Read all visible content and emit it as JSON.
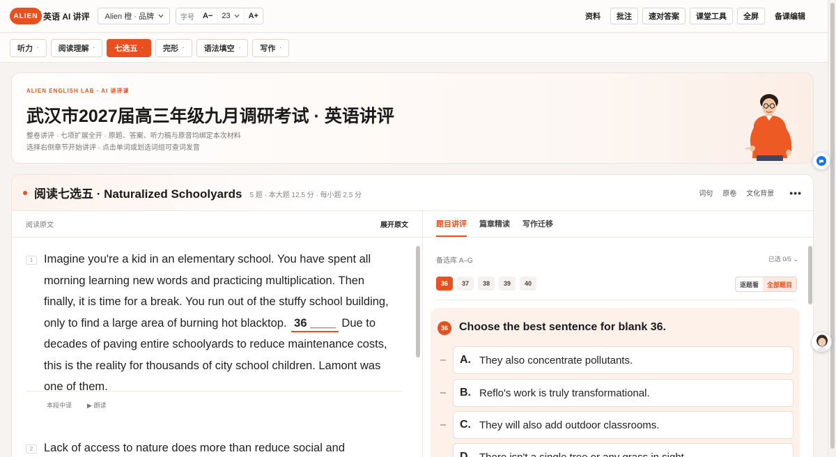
{
  "topbar": {
    "logo_text": "ALIEN",
    "app_title": "英语 AI 讲评",
    "brand_select": "Alien 橙 · 品牌",
    "font_label": "字号",
    "font_decrease": "A−",
    "font_size": "23",
    "font_increase": "A+",
    "right_buttons": [
      "资料",
      "批注",
      "速对答案",
      "课堂工具",
      "全屏",
      "备课编辑"
    ]
  },
  "nav": {
    "tabs": [
      {
        "label": "听力",
        "active": false
      },
      {
        "label": "阅读理解",
        "active": false
      },
      {
        "label": "七选五",
        "active": true
      },
      {
        "label": "完形",
        "active": false
      },
      {
        "label": "语法填空",
        "active": false
      },
      {
        "label": "写作",
        "active": false
      }
    ],
    "dot": "·"
  },
  "hero": {
    "eyebrow": "ALIEN ENGLISH LAB · AI 讲评课",
    "title": "武汉市2027届高三年级九月调研考试 · 英语讲评",
    "subtitle1": "整卷讲评 · 七项扩展全开 · 原题、答案、听力稿与原音均绑定本次材料",
    "subtitle2": "选择右侧章节开始讲评 · 点击单词或划选词组可查词发音"
  },
  "panel": {
    "title": "阅读七选五 · Naturalized Schoolyards",
    "meta": "5 题 · 本大题 12.5 分 · 每小题 2.5 分",
    "links": [
      "词句",
      "原卷",
      "文化背景"
    ],
    "more": "•••"
  },
  "left": {
    "label": "阅读原文",
    "expand": "展开原文",
    "paragraphs": [
      {
        "num": "1",
        "text_before": "Imagine you're a kid in an elementary school. You have spent all morning learning new words and practicing multiplication. Then finally, it is time for a break. You run out of the stuffy school building, only to find a large area of burning hot blacktop.",
        "blank": "36 ____",
        "text_after": "Due to decades of paving entire schoolyards to reduce maintenance costs, this is the reality for thousands of city school children. Lamont was one of them.",
        "actions": [
          "本段中译",
          "▶ 朗读"
        ]
      },
      {
        "num": "2",
        "text_before": "Lack of access to nature does more than reduce social and",
        "blank": "",
        "text_after": ""
      }
    ]
  },
  "right": {
    "tabs": [
      {
        "label": "题目讲评",
        "active": true
      },
      {
        "label": "篇章精读",
        "active": false
      },
      {
        "label": "写作迁移",
        "active": false
      }
    ],
    "pool_label": "备选库 A–G",
    "selected": "已选 0/5",
    "selected_chevron": "⌄",
    "question_numbers": [
      {
        "n": "36",
        "active": true
      },
      {
        "n": "37",
        "active": false
      },
      {
        "n": "38",
        "active": false
      },
      {
        "n": "39",
        "active": false
      },
      {
        "n": "40",
        "active": false
      }
    ],
    "view_toggle": [
      "逐题看",
      "全部题目"
    ],
    "question": {
      "number": "36",
      "title": "Choose the best sentence for blank 36.",
      "options": [
        {
          "letter": "A.",
          "text": "They also concentrate pollutants."
        },
        {
          "letter": "B.",
          "text": "Reflo's work is truly transformational."
        },
        {
          "letter": "C.",
          "text": "They will also add outdoor classrooms."
        },
        {
          "letter": "D.",
          "text": "There isn't a single tree or any grass in sight."
        }
      ]
    }
  },
  "colors": {
    "accent": "#e8501f",
    "accent_soft": "#fdf1ea",
    "text": "#222222",
    "muted": "#777777",
    "border": "#ddd6cf"
  },
  "icons": {
    "chevron": "chevron-down-icon",
    "chat": "chat-bubble-icon",
    "avatar": "assistant-avatar-icon",
    "teacher": "teacher-illustration"
  }
}
